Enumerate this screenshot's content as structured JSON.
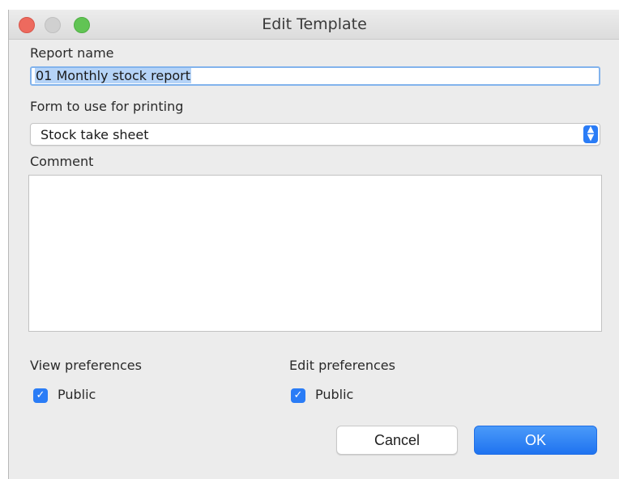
{
  "window": {
    "title": "Edit Template"
  },
  "report_name": {
    "label": "Report name",
    "value": "01 Monthly stock report"
  },
  "form": {
    "label": "Form to use for printing",
    "selected": "Stock take sheet"
  },
  "comment": {
    "label": "Comment",
    "value": ""
  },
  "view_preferences": {
    "label": "View preferences",
    "public_label": "Public",
    "public_checked": true
  },
  "edit_preferences": {
    "label": "Edit preferences",
    "public_label": "Public",
    "public_checked": true
  },
  "buttons": {
    "cancel": "Cancel",
    "ok": "OK"
  },
  "colors": {
    "accent": "#2a7cf6",
    "close": "#ed6a5e",
    "maximize": "#61c454"
  },
  "icons": {
    "checkbox": "checkmark-icon",
    "select": "chevron-updown-icon"
  }
}
